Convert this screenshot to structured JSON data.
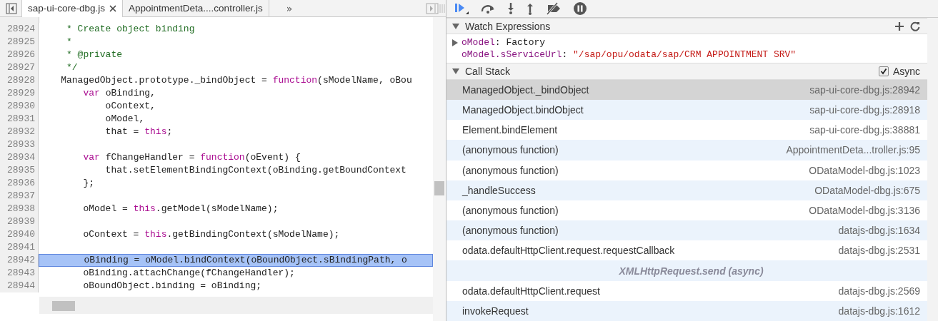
{
  "editor_tabs": [
    {
      "label": "sap-ui-core-dbg.js",
      "selected": true,
      "closable": true
    },
    {
      "label": "AppointmentDeta....controller.js",
      "selected": false,
      "closable": false
    }
  ],
  "more_tabs": "»",
  "code_lines": [
    {
      "number": "28924",
      "current": false,
      "tokens": [
        {
          "kind": "comment",
          "text": "     * Create object binding"
        }
      ]
    },
    {
      "number": "28925",
      "current": false,
      "tokens": [
        {
          "kind": "comment",
          "text": "     *"
        }
      ]
    },
    {
      "number": "28926",
      "current": false,
      "tokens": [
        {
          "kind": "comment",
          "text": "     * @private"
        }
      ]
    },
    {
      "number": "28927",
      "current": false,
      "tokens": [
        {
          "kind": "comment",
          "text": "     */"
        }
      ]
    },
    {
      "number": "28928",
      "current": false,
      "tokens": [
        {
          "kind": "plain",
          "text": "    ManagedObject.prototype._bindObject = "
        },
        {
          "kind": "keyword",
          "text": "function"
        },
        {
          "kind": "plain",
          "text": "(sModelName, oBou"
        }
      ]
    },
    {
      "number": "28929",
      "current": false,
      "tokens": [
        {
          "kind": "keyword",
          "text": "        var"
        },
        {
          "kind": "plain",
          "text": " oBinding,"
        }
      ]
    },
    {
      "number": "28930",
      "current": false,
      "tokens": [
        {
          "kind": "plain",
          "text": "            oContext,"
        }
      ]
    },
    {
      "number": "28931",
      "current": false,
      "tokens": [
        {
          "kind": "plain",
          "text": "            oModel,"
        }
      ]
    },
    {
      "number": "28932",
      "current": false,
      "tokens": [
        {
          "kind": "plain",
          "text": "            that = "
        },
        {
          "kind": "keyword",
          "text": "this"
        },
        {
          "kind": "plain",
          "text": ";"
        }
      ]
    },
    {
      "number": "28933",
      "current": false
    },
    {
      "number": "28934",
      "current": false,
      "tokens": [
        {
          "kind": "keyword",
          "text": "        var"
        },
        {
          "kind": "plain",
          "text": " fChangeHandler = "
        },
        {
          "kind": "keyword",
          "text": "function"
        },
        {
          "kind": "plain",
          "text": "(oEvent) {"
        }
      ]
    },
    {
      "number": "28935",
      "current": false,
      "tokens": [
        {
          "kind": "plain",
          "text": "            that.setElementBindingContext(oBinding.getBoundContext"
        }
      ]
    },
    {
      "number": "28936",
      "current": false,
      "tokens": [
        {
          "kind": "plain",
          "text": "        };"
        }
      ]
    },
    {
      "number": "28937",
      "current": false
    },
    {
      "number": "28938",
      "current": false,
      "tokens": [
        {
          "kind": "plain",
          "text": "        oModel = "
        },
        {
          "kind": "keyword",
          "text": "this"
        },
        {
          "kind": "plain",
          "text": ".getModel(sModelName);"
        }
      ]
    },
    {
      "number": "28939",
      "current": false
    },
    {
      "number": "28940",
      "current": false,
      "tokens": [
        {
          "kind": "plain",
          "text": "        oContext = "
        },
        {
          "kind": "keyword",
          "text": "this"
        },
        {
          "kind": "plain",
          "text": ".getBindingContext(sModelName);"
        }
      ]
    },
    {
      "number": "28941",
      "current": false
    },
    {
      "number": "28942",
      "current": true,
      "tokens": [
        {
          "kind": "plain",
          "text": "        oBinding = oModel.bindContext(oBoundObject.sBindingPath, o"
        }
      ]
    },
    {
      "number": "28943",
      "current": false,
      "tokens": [
        {
          "kind": "plain",
          "text": "        oBinding.attachChange(fChangeHandler);"
        }
      ]
    },
    {
      "number": "28944",
      "current": false,
      "tokens": [
        {
          "kind": "plain",
          "text": "        oBoundObject.binding = oBinding;"
        }
      ]
    }
  ],
  "watch": {
    "title": "Watch Expressions",
    "items": [
      {
        "expandable": true,
        "name": "oModel",
        "separator": ":",
        "value": "Factory",
        "kind": "object"
      },
      {
        "expandable": false,
        "name": "oModel.sServiceUrl",
        "separator": ":",
        "value": "\"/sap/opu/odata/sap/CRM APPOINTMENT SRV\"",
        "kind": "string"
      }
    ]
  },
  "call_stack": {
    "title": "Call Stack",
    "async_label": "Async",
    "async_checked": true,
    "frames": [
      {
        "kind": "frame",
        "function": "ManagedObject._bindObject",
        "location": "sap-ui-core-dbg.js:28942",
        "selected": true
      },
      {
        "kind": "frame",
        "function": "ManagedObject.bindObject",
        "location": "sap-ui-core-dbg.js:28918",
        "selected": false
      },
      {
        "kind": "frame",
        "function": "Element.bindElement",
        "location": "sap-ui-core-dbg.js:38881",
        "selected": false
      },
      {
        "kind": "frame",
        "function": "(anonymous function)",
        "location": "AppointmentDeta...troller.js:95",
        "selected": false
      },
      {
        "kind": "frame",
        "function": "(anonymous function)",
        "location": "ODataModel-dbg.js:1023",
        "selected": false
      },
      {
        "kind": "frame",
        "function": "_handleSuccess",
        "location": "ODataModel-dbg.js:675",
        "selected": false
      },
      {
        "kind": "frame",
        "function": "(anonymous function)",
        "location": "ODataModel-dbg.js:3136",
        "selected": false
      },
      {
        "kind": "frame",
        "function": "(anonymous function)",
        "location": "datajs-dbg.js:1634",
        "selected": false
      },
      {
        "kind": "frame",
        "function": "odata.defaultHttpClient.request.requestCallback",
        "location": "datajs-dbg.js:2531",
        "selected": false
      },
      {
        "kind": "async",
        "function": "XMLHttpRequest.send (async)",
        "selected": false
      },
      {
        "kind": "frame",
        "function": "odata.defaultHttpClient.request",
        "location": "datajs-dbg.js:2569",
        "selected": false
      },
      {
        "kind": "frame",
        "function": "invokeRequest",
        "location": "datajs-dbg.js:1612",
        "selected": false
      }
    ]
  }
}
